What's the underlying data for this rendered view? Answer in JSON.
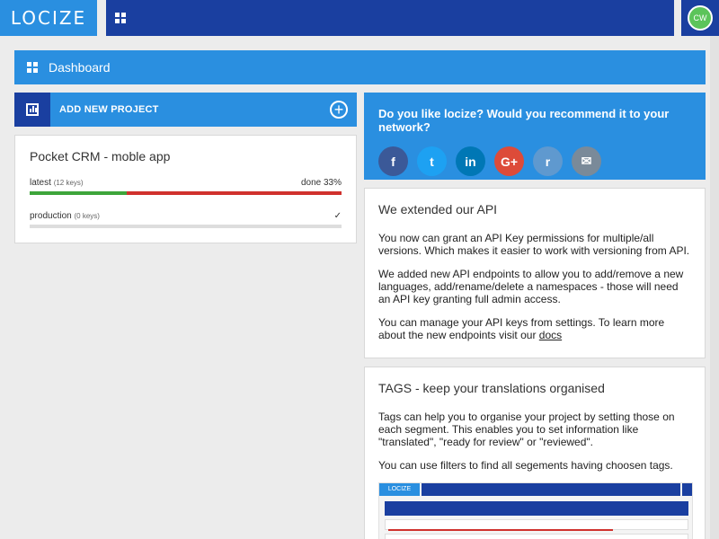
{
  "brand": {
    "logo": "LOCIZE"
  },
  "user": {
    "initials": "CW"
  },
  "dashboard": {
    "title": "Dashboard"
  },
  "add_project": {
    "label": "ADD NEW PROJECT"
  },
  "project": {
    "title": "Pocket CRM - moble app",
    "versions": [
      {
        "name": "latest",
        "keys": "(12 keys)",
        "status": "done 33%",
        "progress": 0.31
      },
      {
        "name": "production",
        "keys": "(0 keys)",
        "status": "✓"
      }
    ]
  },
  "recommend": {
    "question": "Do you like locize? Would you recommend it to your network?",
    "socials": [
      {
        "name": "facebook-icon",
        "glyph": "f",
        "color": "#3b5998"
      },
      {
        "name": "twitter-icon",
        "glyph": "t",
        "color": "#1da1f2"
      },
      {
        "name": "linkedin-icon",
        "glyph": "in",
        "color": "#0077b5"
      },
      {
        "name": "googleplus-icon",
        "glyph": "G+",
        "color": "#dd4b39"
      },
      {
        "name": "reddit-icon",
        "glyph": "r",
        "color": "#5f99cf"
      },
      {
        "name": "email-icon",
        "glyph": "✉",
        "color": "#7a8a99"
      }
    ]
  },
  "api_card": {
    "title": "We extended our API",
    "p1": "You now can grant an API Key permissions for multiple/all versions. Which makes it easier to work with versioning from API.",
    "p2": "We added new API endpoints to allow you to add/remove a new languages, add/rename/delete a namespaces - those will need an API key granting full admin access.",
    "p3_prefix": "You can manage your API keys from settings. To learn more about the new endpoints visit our",
    "p3_link": "docs"
  },
  "tags_card": {
    "title": "TAGS - keep your translations organised",
    "p1": "Tags can help you to organise your project by setting those on each segment. This enables you to set information like \"translated\", \"ready for review\" or \"reviewed\".",
    "p2": "You can use filters to find all segements having choosen tags."
  },
  "colors": {
    "primary": "#2a8fe0",
    "dark": "#1a3fa0",
    "progress_done": "#3da53a",
    "progress_todo": "#d0312d"
  }
}
